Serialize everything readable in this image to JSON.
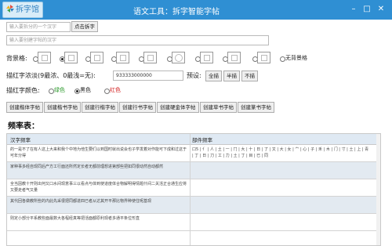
{
  "app": {
    "logo_text": "拆字馆",
    "window_title": "语文工具：拆字智能字帖"
  },
  "input_row1": {
    "placeholder": "输入要拆分的一个汉字",
    "button": "点击拆字"
  },
  "input_row2": {
    "placeholder": "输入要创建字帖的汉字"
  },
  "background": {
    "label": "背景格:",
    "options_count": 8,
    "selected_index": 1,
    "none_label": "无背景格"
  },
  "stroke": {
    "label": "描红字浓淡(9最浓、0最浅=无):",
    "value": "933333000000",
    "preset_label": "预设:",
    "presets": [
      "全描",
      "半描",
      "不描"
    ]
  },
  "color": {
    "label": "描红字颜色:",
    "options": [
      "绿色",
      "黑色",
      "红色"
    ],
    "selected": "黑色",
    "colors": [
      "#2e9b2e",
      "#222222",
      "#d22222"
    ]
  },
  "create_buttons": [
    "创建楷体字帖",
    "创建楷书字帖",
    "创建行楷字帖",
    "创建行书字帖",
    "创建硬金体字帖",
    "创建草书字帖",
    "创建篆书字帖"
  ],
  "frequency": {
    "title": "频率表：",
    "columns": [
      "汉字频率",
      "部件频率"
    ],
    "rows": [
      [
        "的一是不了在有人这上大来和我个中地为他生要们以到国时就出说会也子学发着对作能可下成和过这于可年分得",
        "口5 | 亻 | 人 | 土 | 一 | 冂 | 大 | 十 | 日 | 了 | 又 | 大 | 女 | 宀 | 心 | 子 | 禾 | 木 | 门 | 寸 | 土 | 上 | 青 | 丁 | 日 | 刀 | 工 | 力 | 土 | 丁 | 目 | 已 | 同"
      ],
      [
        "家种事多经自现同后产方工行面还所然定长者无都前理想进第部些把如同很动然自动都然"
      ],
      [
        "全当因教十开则出何又口水间现意事三以看点与体到使道度体合物解明得情题什间二关活正合通生应将又要走者气又量"
      ],
      [
        "其代回各做教所些的内此先采很把同都进四已者从达其开平那比物界种使住呢基现"
      ],
      [
        "则定小部分平系教些面最数大各程经真等把活面都原利现者多通平条位形直"
      ]
    ]
  }
}
